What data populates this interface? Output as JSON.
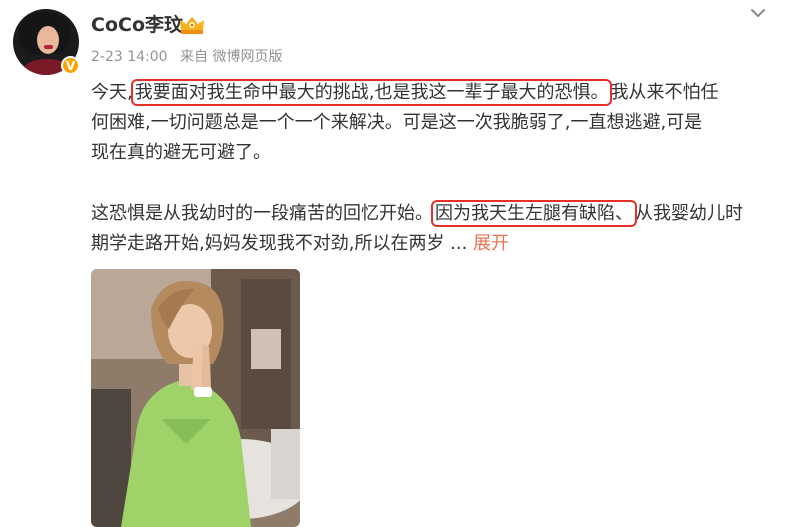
{
  "post": {
    "author": "CoCo李玟",
    "date": "2-23 14:00",
    "source": "来自 微博网页版",
    "para1": {
      "line1_pre": "今天,",
      "line1_hl": "我要面对我生命中最大的挑战,也是我这一辈子最大的恐惧。",
      "line1_post": "我从来不怕任",
      "line2": "何困难,一切问题总是一个一个来解决。可是这一次我脆弱了,一直想逃避,可是",
      "line3": "现在真的避无可避了。"
    },
    "para2": {
      "line1_pre": "这恐惧是从我幼时的一段痛苦的回忆开始。",
      "line1_hl": "因为我天生左腿有缺陷、",
      "line1_post": "从我婴幼儿时",
      "line2": "期学走路开始,妈妈发现我不对劲,所以在两岁 ...",
      "expand_label": "展开"
    },
    "verified_badge": "V",
    "icons": [
      "vip-crown-icon",
      "chevron-down-icon",
      "verified-icon"
    ],
    "colors": {
      "highlight": "#e8302b",
      "expand": "#eb7350",
      "meta": "#939393"
    }
  }
}
